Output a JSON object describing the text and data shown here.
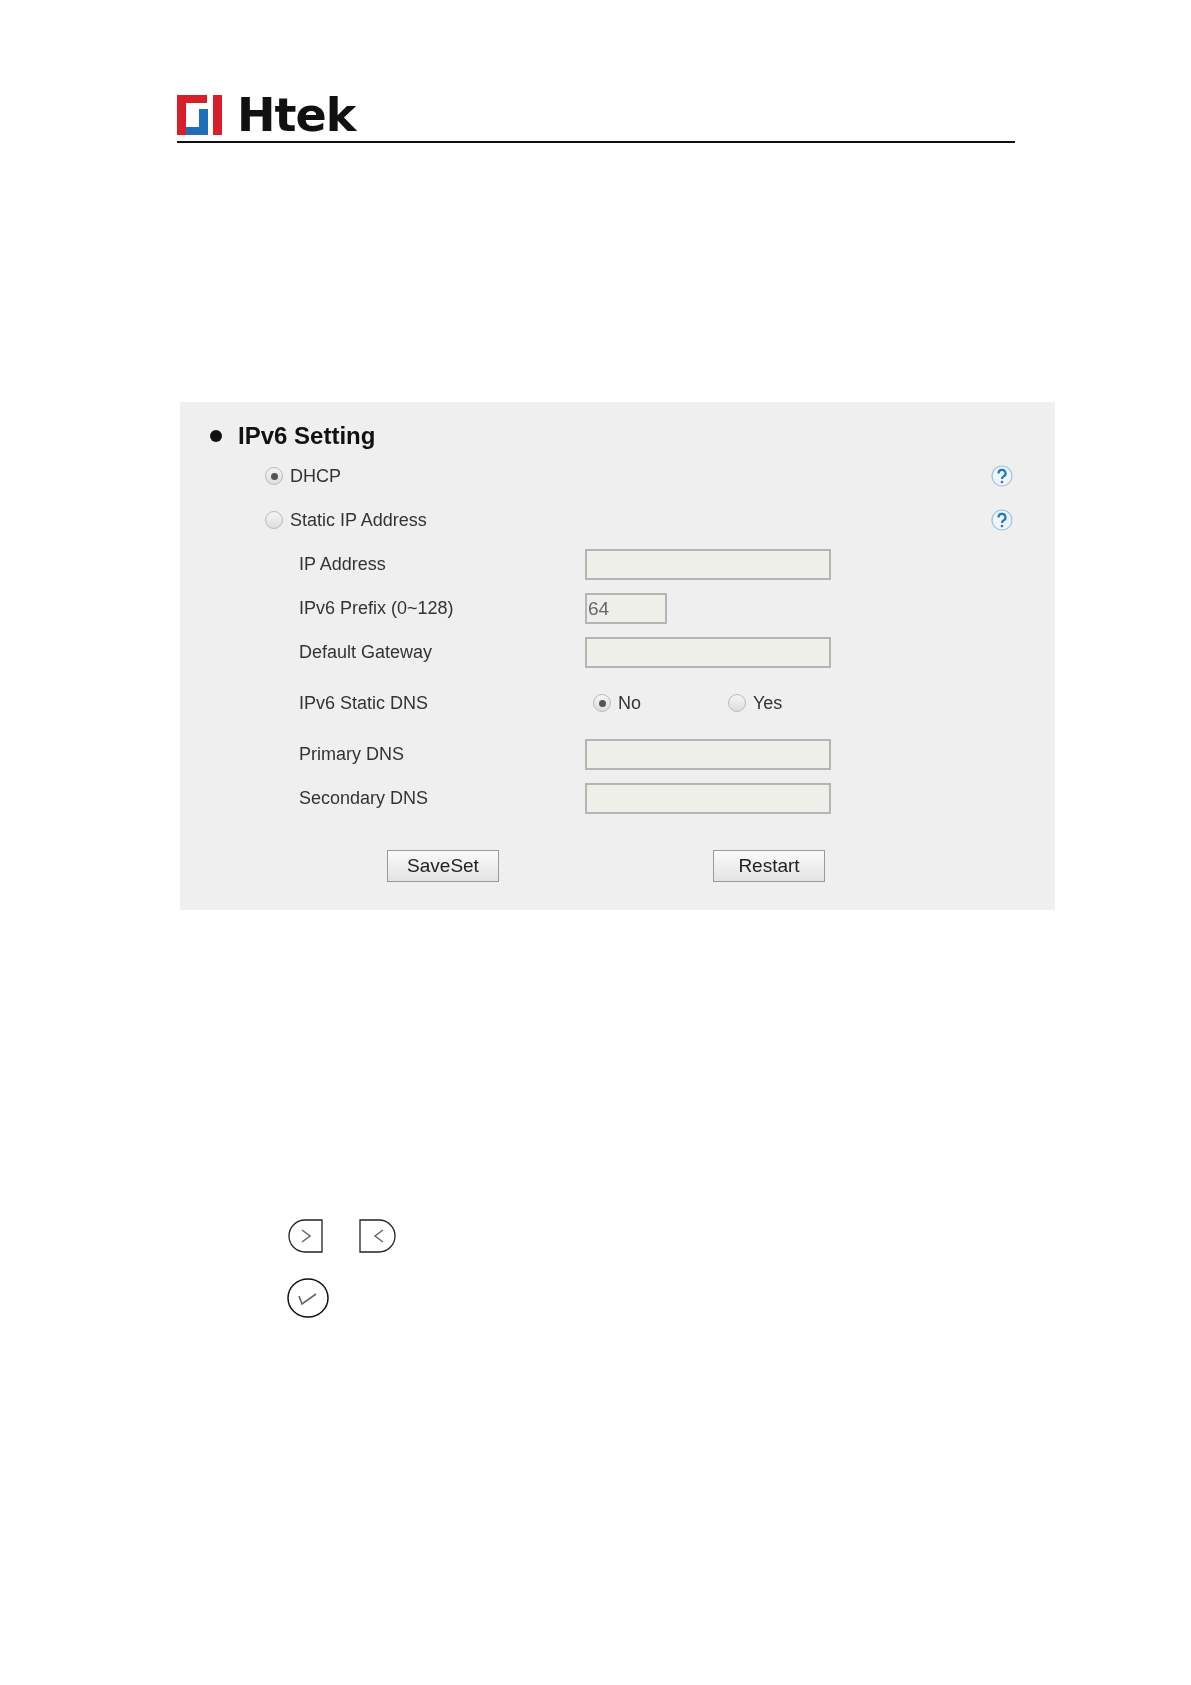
{
  "logo": {
    "text": "Htek"
  },
  "section": {
    "title": "IPv6 Setting",
    "modes": [
      {
        "label": "DHCP",
        "selected": true
      },
      {
        "label": "Static IP Address",
        "selected": false
      }
    ],
    "fields": [
      {
        "kind": "input",
        "label": "IP Address"
      },
      {
        "kind": "short_input",
        "label": "IPv6 Prefix (0~128)",
        "value": "64"
      },
      {
        "kind": "input",
        "label": "Default Gateway"
      },
      {
        "kind": "radio",
        "label": "IPv6 Static DNS",
        "options": [
          {
            "label": "No",
            "selected": true
          },
          {
            "label": "Yes",
            "selected": false
          }
        ]
      },
      {
        "kind": "input",
        "label": "Primary DNS"
      },
      {
        "kind": "input",
        "label": "Secondary DNS"
      }
    ],
    "buttons": [
      "SaveSet",
      "Restart"
    ]
  }
}
